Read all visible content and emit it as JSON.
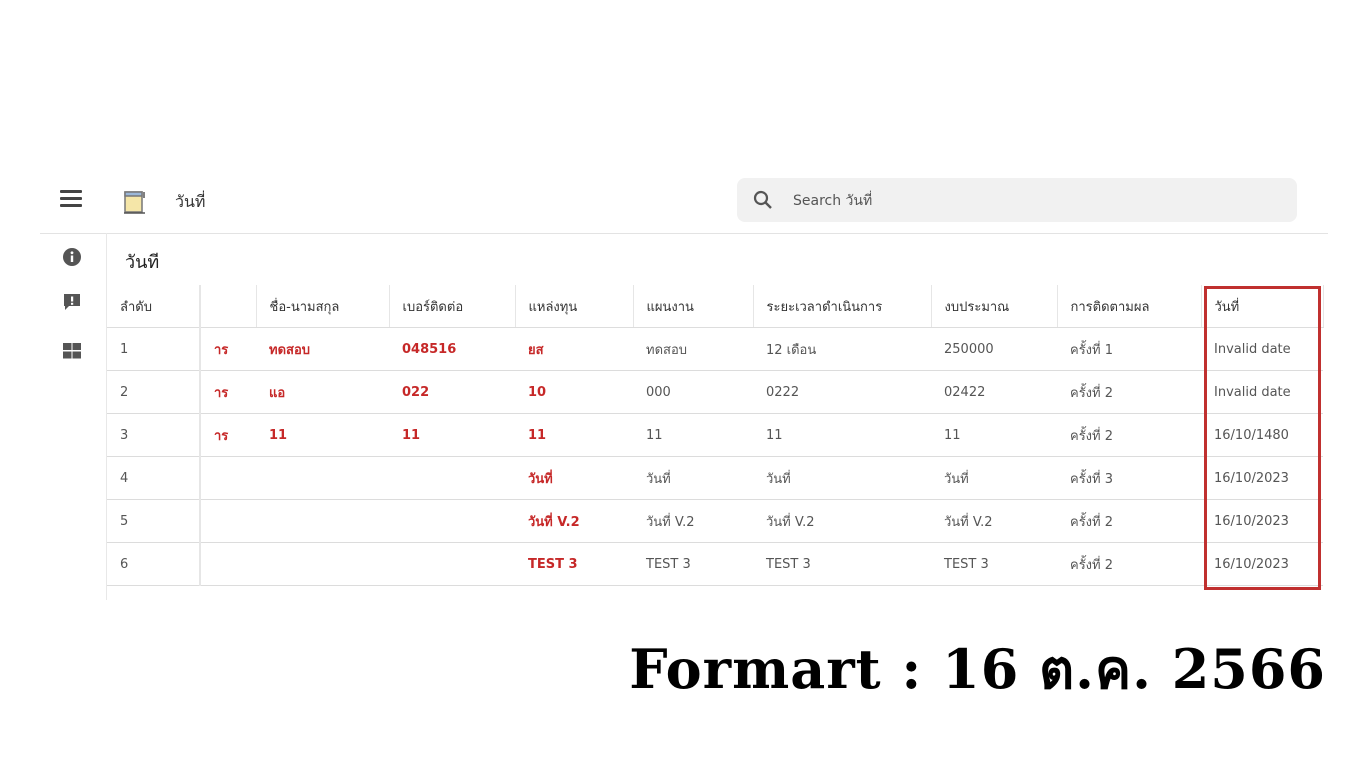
{
  "header": {
    "title": "วันที่",
    "search_placeholder": "Search วันที่"
  },
  "rail": {
    "icons": [
      "info-icon",
      "feedback-icon",
      "dashboard-icon"
    ]
  },
  "view": {
    "title": "วันที"
  },
  "table": {
    "columns": [
      "ลำดับ",
      "",
      "ชื่อ-นามสกุล",
      "เบอร์ติดต่อ",
      "แหล่งทุน",
      "แผนงาน",
      "ระยะเวลาดำเนินการ",
      "งบประมาณ",
      "การติดตามผล",
      "วันที่"
    ],
    "rows": [
      [
        "1",
        "าร",
        "ทดสอบ",
        "048516",
        "ยส",
        "ทดสอบ",
        "12 เดือน",
        "250000",
        "ครั้งที่ 1",
        "Invalid date"
      ],
      [
        "2",
        "าร",
        "แอ",
        "022",
        "10",
        "000",
        "0222",
        "02422",
        "ครั้งที่ 2",
        "Invalid date"
      ],
      [
        "3",
        "าร",
        "11",
        "11",
        "11",
        "11",
        "11",
        "11",
        "ครั้งที่ 2",
        "16/10/1480"
      ],
      [
        "4",
        "",
        "",
        "",
        "วันที่",
        "วันที่",
        "วันที่",
        "วันที่",
        "ครั้งที่ 3",
        "16/10/2023"
      ],
      [
        "5",
        "",
        "",
        "",
        "วันที่ V.2",
        "วันที่ V.2",
        "วันที่ V.2",
        "วันที่ V.2",
        "ครั้งที่ 2",
        "16/10/2023"
      ],
      [
        "6",
        "",
        "",
        "",
        "TEST 3",
        "TEST 3",
        "TEST 3",
        "TEST 3",
        "ครั้งที่ 2",
        "16/10/2023"
      ]
    ]
  },
  "annotation": {
    "caption": "Formart :  16 ต.ค. 2566",
    "highlight_color": "#c0302f"
  },
  "colors": {
    "accent_red": "#c62828"
  }
}
